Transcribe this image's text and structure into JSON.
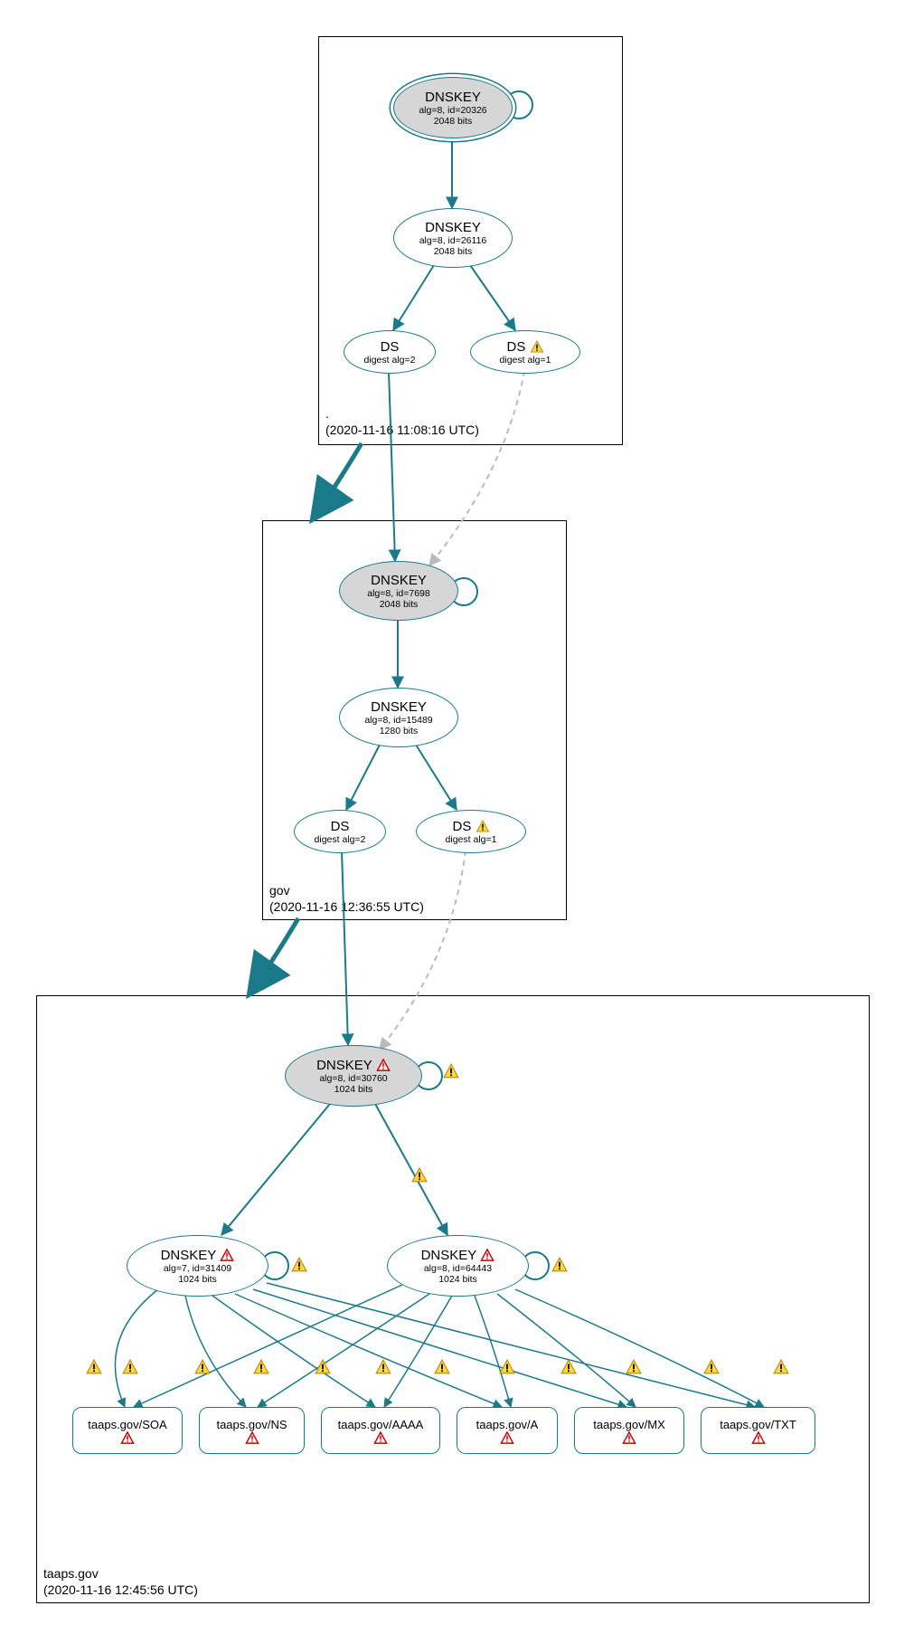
{
  "colors": {
    "stroke": "#1a7a8a",
    "ksk_fill": "#d6d6d6",
    "warn_fill": "#ffd93b",
    "warn_stroke": "#b8860b",
    "err_fill": "#ffffff",
    "err_stroke": "#cc0000"
  },
  "zones": {
    "root": {
      "name": ".",
      "timestamp": "(2020-11-16 11:08:16 UTC)"
    },
    "gov": {
      "name": "gov",
      "timestamp": "(2020-11-16 12:36:55 UTC)"
    },
    "taaps": {
      "name": "taaps.gov",
      "timestamp": "(2020-11-16 12:45:56 UTC)"
    }
  },
  "nodes": {
    "root_ksk": {
      "title": "DNSKEY",
      "sub1": "alg=8, id=20326",
      "sub2": "2048 bits"
    },
    "root_zsk": {
      "title": "DNSKEY",
      "sub1": "alg=8, id=26116",
      "sub2": "2048 bits"
    },
    "root_ds2": {
      "title": "DS",
      "sub1": "digest alg=2"
    },
    "root_ds1": {
      "title": "DS",
      "sub1": "digest alg=1"
    },
    "gov_ksk": {
      "title": "DNSKEY",
      "sub1": "alg=8, id=7698",
      "sub2": "2048 bits"
    },
    "gov_zsk": {
      "title": "DNSKEY",
      "sub1": "alg=8, id=15489",
      "sub2": "1280 bits"
    },
    "gov_ds2": {
      "title": "DS",
      "sub1": "digest alg=2"
    },
    "gov_ds1": {
      "title": "DS",
      "sub1": "digest alg=1"
    },
    "taaps_ksk": {
      "title": "DNSKEY",
      "sub1": "alg=8, id=30760",
      "sub2": "1024 bits"
    },
    "taaps_zsk1": {
      "title": "DNSKEY",
      "sub1": "alg=7, id=31409",
      "sub2": "1024 bits"
    },
    "taaps_zsk2": {
      "title": "DNSKEY",
      "sub1": "alg=8, id=64443",
      "sub2": "1024 bits"
    }
  },
  "rrsets": {
    "soa": "taaps.gov/SOA",
    "ns": "taaps.gov/NS",
    "aaaa": "taaps.gov/AAAA",
    "a": "taaps.gov/A",
    "mx": "taaps.gov/MX",
    "txt": "taaps.gov/TXT"
  },
  "chart_data": {
    "type": "graph",
    "description": "DNSSEC authentication chain graph from root (.) through gov to taaps.gov, showing DNSKEY and DS records with warning and error annotations.",
    "zones": [
      {
        "name": ".",
        "timestamp": "2020-11-16 11:08:16 UTC"
      },
      {
        "name": "gov",
        "timestamp": "2020-11-16 12:36:55 UTC"
      },
      {
        "name": "taaps.gov",
        "timestamp": "2020-11-16 12:45:56 UTC"
      }
    ],
    "nodes": [
      {
        "id": "root_ksk",
        "zone": ".",
        "type": "DNSKEY",
        "alg": 8,
        "keyid": 20326,
        "bits": 2048,
        "role": "KSK",
        "status": "secure"
      },
      {
        "id": "root_zsk",
        "zone": ".",
        "type": "DNSKEY",
        "alg": 8,
        "keyid": 26116,
        "bits": 2048,
        "role": "ZSK",
        "status": "secure"
      },
      {
        "id": "root_ds2",
        "zone": ".",
        "type": "DS",
        "digest_alg": 2,
        "status": "secure"
      },
      {
        "id": "root_ds1",
        "zone": ".",
        "type": "DS",
        "digest_alg": 1,
        "status": "warning"
      },
      {
        "id": "gov_ksk",
        "zone": "gov",
        "type": "DNSKEY",
        "alg": 8,
        "keyid": 7698,
        "bits": 2048,
        "role": "KSK",
        "status": "secure"
      },
      {
        "id": "gov_zsk",
        "zone": "gov",
        "type": "DNSKEY",
        "alg": 8,
        "keyid": 15489,
        "bits": 1280,
        "role": "ZSK",
        "status": "secure"
      },
      {
        "id": "gov_ds2",
        "zone": "gov",
        "type": "DS",
        "digest_alg": 2,
        "status": "secure"
      },
      {
        "id": "gov_ds1",
        "zone": "gov",
        "type": "DS",
        "digest_alg": 1,
        "status": "warning"
      },
      {
        "id": "taaps_ksk",
        "zone": "taaps.gov",
        "type": "DNSKEY",
        "alg": 8,
        "keyid": 30760,
        "bits": 1024,
        "role": "KSK",
        "status": "error"
      },
      {
        "id": "taaps_zsk1",
        "zone": "taaps.gov",
        "type": "DNSKEY",
        "alg": 7,
        "keyid": 31409,
        "bits": 1024,
        "role": "ZSK",
        "status": "error"
      },
      {
        "id": "taaps_zsk2",
        "zone": "taaps.gov",
        "type": "DNSKEY",
        "alg": 8,
        "keyid": 64443,
        "bits": 1024,
        "role": "ZSK",
        "status": "error"
      },
      {
        "id": "rr_soa",
        "zone": "taaps.gov",
        "type": "RRset",
        "name": "taaps.gov/SOA",
        "status": "error"
      },
      {
        "id": "rr_ns",
        "zone": "taaps.gov",
        "type": "RRset",
        "name": "taaps.gov/NS",
        "status": "error"
      },
      {
        "id": "rr_aaaa",
        "zone": "taaps.gov",
        "type": "RRset",
        "name": "taaps.gov/AAAA",
        "status": "error"
      },
      {
        "id": "rr_a",
        "zone": "taaps.gov",
        "type": "RRset",
        "name": "taaps.gov/A",
        "status": "error"
      },
      {
        "id": "rr_mx",
        "zone": "taaps.gov",
        "type": "RRset",
        "name": "taaps.gov/MX",
        "status": "error"
      },
      {
        "id": "rr_txt",
        "zone": "taaps.gov",
        "type": "RRset",
        "name": "taaps.gov/TXT",
        "status": "error"
      }
    ],
    "edges": [
      {
        "from": "root_ksk",
        "to": "root_ksk",
        "kind": "self-sign",
        "status": "secure"
      },
      {
        "from": "root_ksk",
        "to": "root_zsk",
        "kind": "signs",
        "status": "secure"
      },
      {
        "from": "root_zsk",
        "to": "root_ds2",
        "kind": "signs",
        "status": "secure"
      },
      {
        "from": "root_zsk",
        "to": "root_ds1",
        "kind": "signs",
        "status": "secure"
      },
      {
        "from": "root_ds2",
        "to": "gov_ksk",
        "kind": "delegation",
        "status": "secure"
      },
      {
        "from": "root_ds1",
        "to": "gov_ksk",
        "kind": "delegation",
        "status": "insecure",
        "style": "dashed"
      },
      {
        "from": "gov_ksk",
        "to": "gov_ksk",
        "kind": "self-sign",
        "status": "secure"
      },
      {
        "from": "gov_ksk",
        "to": "gov_zsk",
        "kind": "signs",
        "status": "secure"
      },
      {
        "from": "gov_zsk",
        "to": "gov_ds2",
        "kind": "signs",
        "status": "secure"
      },
      {
        "from": "gov_zsk",
        "to": "gov_ds1",
        "kind": "signs",
        "status": "secure"
      },
      {
        "from": "gov_ds2",
        "to": "taaps_ksk",
        "kind": "delegation",
        "status": "secure"
      },
      {
        "from": "gov_ds1",
        "to": "taaps_ksk",
        "kind": "delegation",
        "status": "insecure",
        "style": "dashed"
      },
      {
        "from": "taaps_ksk",
        "to": "taaps_ksk",
        "kind": "self-sign",
        "status": "warning"
      },
      {
        "from": "taaps_ksk",
        "to": "taaps_zsk1",
        "kind": "signs",
        "status": "secure"
      },
      {
        "from": "taaps_ksk",
        "to": "taaps_zsk2",
        "kind": "signs",
        "status": "warning"
      },
      {
        "from": "taaps_zsk1",
        "to": "taaps_zsk1",
        "kind": "self-sign",
        "status": "warning"
      },
      {
        "from": "taaps_zsk2",
        "to": "taaps_zsk2",
        "kind": "self-sign",
        "status": "warning"
      },
      {
        "from": "taaps_zsk1",
        "to": "rr_soa",
        "kind": "signs",
        "status": "warning"
      },
      {
        "from": "taaps_zsk1",
        "to": "rr_ns",
        "kind": "signs",
        "status": "warning"
      },
      {
        "from": "taaps_zsk1",
        "to": "rr_aaaa",
        "kind": "signs",
        "status": "warning"
      },
      {
        "from": "taaps_zsk1",
        "to": "rr_a",
        "kind": "signs",
        "status": "warning"
      },
      {
        "from": "taaps_zsk1",
        "to": "rr_mx",
        "kind": "signs",
        "status": "warning"
      },
      {
        "from": "taaps_zsk1",
        "to": "rr_txt",
        "kind": "signs",
        "status": "warning"
      },
      {
        "from": "taaps_zsk2",
        "to": "rr_soa",
        "kind": "signs",
        "status": "warning"
      },
      {
        "from": "taaps_zsk2",
        "to": "rr_ns",
        "kind": "signs",
        "status": "warning"
      },
      {
        "from": "taaps_zsk2",
        "to": "rr_aaaa",
        "kind": "signs",
        "status": "warning"
      },
      {
        "from": "taaps_zsk2",
        "to": "rr_a",
        "kind": "signs",
        "status": "warning"
      },
      {
        "from": "taaps_zsk2",
        "to": "rr_mx",
        "kind": "signs",
        "status": "warning"
      },
      {
        "from": "taaps_zsk2",
        "to": "rr_txt",
        "kind": "signs",
        "status": "warning"
      },
      {
        "from": "root_zone",
        "to": "gov_zone",
        "kind": "zone-delegation",
        "status": "secure"
      },
      {
        "from": "gov_zone",
        "to": "taaps_zone",
        "kind": "zone-delegation",
        "status": "secure"
      }
    ]
  }
}
